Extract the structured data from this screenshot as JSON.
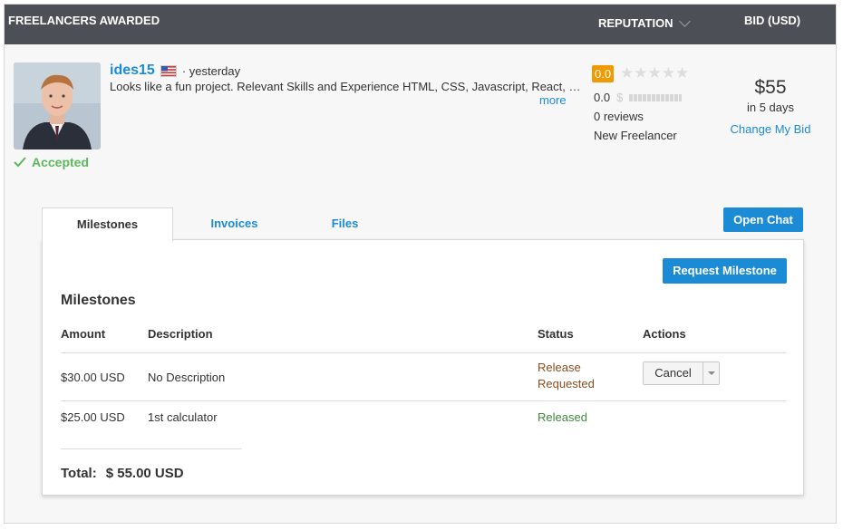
{
  "header": {
    "freelancers_awarded": "FREELANCERS AWARDED",
    "reputation": "REPUTATION",
    "bid": "BID (USD)"
  },
  "freelancer": {
    "username": "ides15",
    "flag": "us-flag-icon",
    "time": "· yesterday",
    "proposal": "Looks like a fun project. Relevant Skills and Experience HTML, CSS, Javascript, React, R...",
    "more": "more",
    "status": "Accepted",
    "rating": "0.0",
    "stars": "★★★★★",
    "earnings_score": "0.0",
    "reviews": "0 reviews",
    "label": "New Freelancer"
  },
  "bid": {
    "amount": "$55",
    "days": "in 5 days",
    "change": "Change My Bid"
  },
  "tabs": {
    "milestones": "Milestones",
    "invoices": "Invoices",
    "files": "Files"
  },
  "actions": {
    "open_chat": "Open Chat",
    "request_milestone": "Request Milestone"
  },
  "milestones": {
    "title": "Milestones",
    "columns": {
      "amount": "Amount",
      "description": "Description",
      "status": "Status",
      "actions": "Actions"
    },
    "rows": [
      {
        "amount": "$30.00 USD",
        "description": "No Description",
        "status": "Release Requested",
        "action": "Cancel"
      },
      {
        "amount": "$25.00 USD",
        "description": "1st calculator",
        "status": "Released",
        "action": ""
      }
    ],
    "total_label": "Total:",
    "total_value": "$ 55.00 USD"
  },
  "colors": {
    "header_bg": "#4c5056",
    "link": "#1c8bd6",
    "accent_orange": "#f29900",
    "accepted_green": "#5cb85c"
  }
}
